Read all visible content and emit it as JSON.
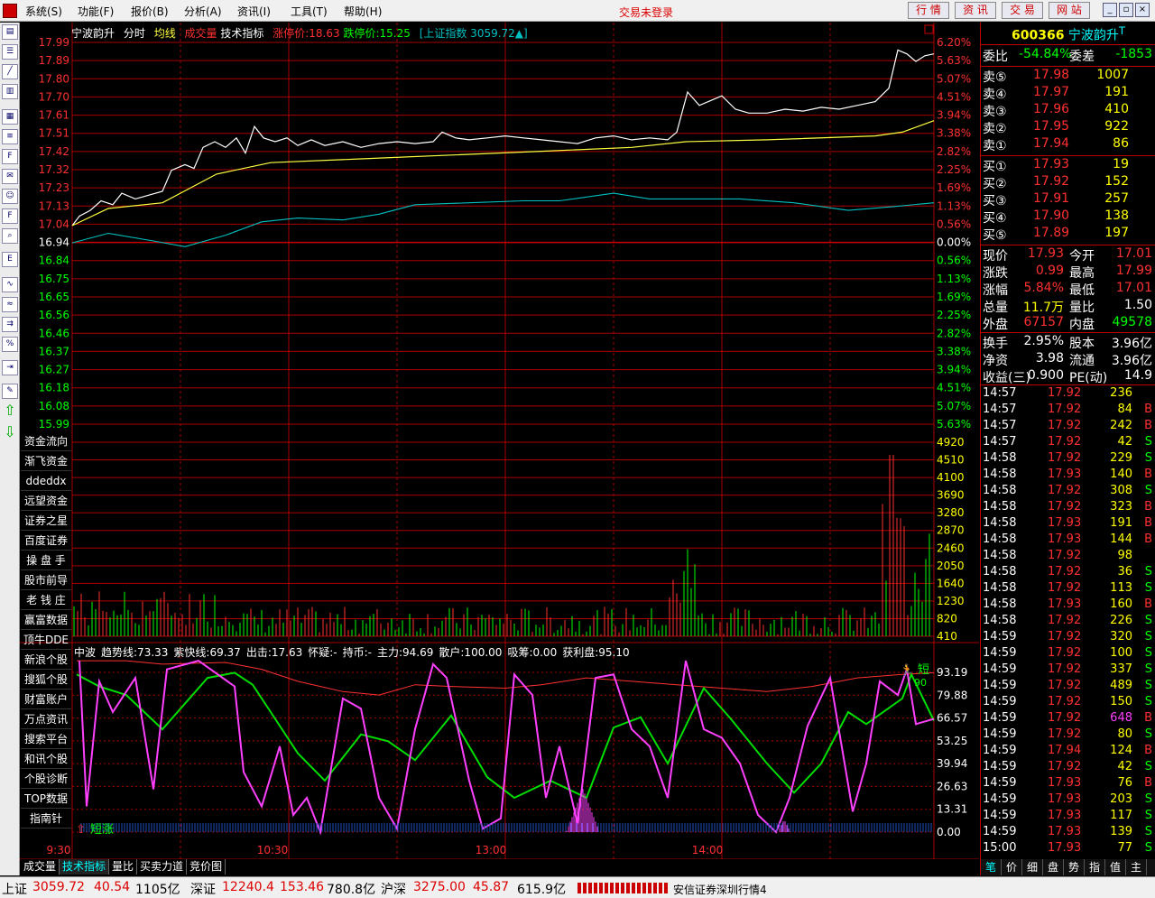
{
  "menu": {
    "items": [
      "系统(S)",
      "功能(F)",
      "报价(B)",
      "分析(A)",
      "资讯(I)",
      "工具(T)",
      "帮助(H)"
    ],
    "notice": "交易未登录",
    "quick_buttons": [
      "行 情",
      "资 讯",
      "交 易",
      "网 站"
    ]
  },
  "chart_info": {
    "name": "宁波韵升",
    "period": "分时",
    "avg_label": "均线",
    "vol_label": "成交量",
    "tech_label": "技术指标",
    "limit_up": "涨停价:18.63",
    "limit_down": "跌停价:15.25",
    "index": "[上证指数 3059.72▲]"
  },
  "price_axis": {
    "left": [
      "17.99",
      "17.89",
      "17.80",
      "17.70",
      "17.61",
      "17.51",
      "17.42",
      "17.32",
      "17.23",
      "17.13",
      "17.04",
      "16.94",
      "16.84",
      "16.75",
      "16.65",
      "16.56",
      "16.46",
      "16.37",
      "16.27",
      "16.18",
      "16.08",
      "15.99"
    ],
    "right": [
      "6.20%",
      "5.63%",
      "5.07%",
      "4.51%",
      "3.94%",
      "3.38%",
      "2.82%",
      "2.25%",
      "1.69%",
      "1.13%",
      "0.56%",
      "0.00%",
      "0.56%",
      "1.13%",
      "1.69%",
      "2.25%",
      "2.82%",
      "3.38%",
      "3.94%",
      "4.51%",
      "5.07%",
      "5.63%"
    ],
    "prev_close": 16.94
  },
  "volume_axis": [
    "4920",
    "4510",
    "4100",
    "3690",
    "3280",
    "2870",
    "2460",
    "2050",
    "1640",
    "1230",
    "820",
    "410"
  ],
  "indicator": {
    "labels": [
      "中波",
      "趋势线:73.33",
      "紫快线:69.37",
      "出击:17.63",
      "怀疑:-",
      "持币:-",
      "主力:94.69",
      "散户:100.00",
      "吸筹:0.00",
      "获利盘:95.10"
    ],
    "axis": [
      "93.19",
      "79.88",
      "66.57",
      "53.25",
      "39.94",
      "26.63",
      "13.31",
      "0.00"
    ],
    "signal_bottom": "短涨",
    "signal_top": "短",
    "signal_top2": "90"
  },
  "time_axis": [
    "9:30",
    "10:30",
    "13:00",
    "14:00"
  ],
  "left_nav": [
    "资金流向",
    "渐飞资金",
    "ddeddx",
    "远望资金",
    "证券之星",
    "百度证券",
    "操 盘 手",
    "股市前导",
    "老 钱 庄",
    "赢富数据",
    "顶牛DDE",
    "新浪个股",
    "搜狐个股",
    "财富账户",
    "万点资讯",
    "搜索平台",
    "和讯个股",
    "个股诊断",
    "TOP数据",
    "指南针"
  ],
  "toolbar_icons": [
    "quote-icon",
    "list-icon",
    "chart-icon",
    "kline-icon",
    "news-icon",
    "table-icon",
    "f10-icon",
    "mail-icon",
    "users-icon",
    "f10b-icon",
    "search-icon",
    "etf-icon",
    "trend-icon",
    "compare-icon",
    "multi-icon",
    "percent-icon",
    "export-icon",
    "pen-icon",
    "up-arrow-icon",
    "down-arrow-icon"
  ],
  "bottom_tabs": [
    "成交量",
    "技术指标",
    "量比",
    "买卖力道",
    "竞价图"
  ],
  "quote": {
    "code": "600366",
    "name": "宁波韵升",
    "suffix": "T",
    "weibi_label": "委比",
    "weibi": "-54.84%",
    "weicha_label": "委差",
    "weicha": "-1853",
    "asks": [
      {
        "label": "卖⑤",
        "price": "17.98",
        "vol": "1007"
      },
      {
        "label": "卖④",
        "price": "17.97",
        "vol": "191"
      },
      {
        "label": "卖③",
        "price": "17.96",
        "vol": "410"
      },
      {
        "label": "卖②",
        "price": "17.95",
        "vol": "922"
      },
      {
        "label": "卖①",
        "price": "17.94",
        "vol": "86"
      }
    ],
    "bids": [
      {
        "label": "买①",
        "price": "17.93",
        "vol": "19"
      },
      {
        "label": "买②",
        "price": "17.92",
        "vol": "152"
      },
      {
        "label": "买③",
        "price": "17.91",
        "vol": "257"
      },
      {
        "label": "买④",
        "price": "17.90",
        "vol": "138"
      },
      {
        "label": "买⑤",
        "price": "17.89",
        "vol": "197"
      }
    ],
    "stats": [
      {
        "l1": "现价",
        "v1": "17.93",
        "c1": "#ff3030",
        "l2": "今开",
        "v2": "17.01",
        "c2": "#ff3030"
      },
      {
        "l1": "涨跌",
        "v1": "0.99",
        "c1": "#ff3030",
        "l2": "最高",
        "v2": "17.99",
        "c2": "#ff3030"
      },
      {
        "l1": "涨幅",
        "v1": "5.84%",
        "c1": "#ff3030",
        "l2": "最低",
        "v2": "17.01",
        "c2": "#ff3030"
      },
      {
        "l1": "总量",
        "v1": "11.7万",
        "c1": "#ffff00",
        "l2": "量比",
        "v2": "1.50",
        "c2": "#ffffff"
      },
      {
        "l1": "外盘",
        "v1": "67157",
        "c1": "#ff3030",
        "l2": "内盘",
        "v2": "49578",
        "c2": "#00ff00"
      }
    ],
    "stats2": [
      {
        "l1": "换手",
        "v1": "2.95%",
        "l2": "股本",
        "v2": "3.96亿"
      },
      {
        "l1": "净资",
        "v1": "3.98",
        "l2": "流通",
        "v2": "3.96亿"
      },
      {
        "l1": "收益(三)",
        "v1": "0.900",
        "l2": "PE(动)",
        "v2": "14.9"
      }
    ]
  },
  "ticks": [
    {
      "t": "14:57",
      "p": "17.92",
      "v": "236",
      "d": ""
    },
    {
      "t": "14:57",
      "p": "17.92",
      "v": "84",
      "d": "B"
    },
    {
      "t": "14:57",
      "p": "17.92",
      "v": "242",
      "d": "B"
    },
    {
      "t": "14:57",
      "p": "17.92",
      "v": "42",
      "d": "S"
    },
    {
      "t": "14:58",
      "p": "17.92",
      "v": "229",
      "d": "S"
    },
    {
      "t": "14:58",
      "p": "17.93",
      "v": "140",
      "d": "B"
    },
    {
      "t": "14:58",
      "p": "17.92",
      "v": "308",
      "d": "S"
    },
    {
      "t": "14:58",
      "p": "17.92",
      "v": "323",
      "d": "B"
    },
    {
      "t": "14:58",
      "p": "17.93",
      "v": "191",
      "d": "B"
    },
    {
      "t": "14:58",
      "p": "17.93",
      "v": "144",
      "d": "B"
    },
    {
      "t": "14:58",
      "p": "17.92",
      "v": "98",
      "d": ""
    },
    {
      "t": "14:58",
      "p": "17.92",
      "v": "36",
      "d": "S"
    },
    {
      "t": "14:58",
      "p": "17.92",
      "v": "113",
      "d": "S"
    },
    {
      "t": "14:58",
      "p": "17.93",
      "v": "160",
      "d": "B"
    },
    {
      "t": "14:58",
      "p": "17.92",
      "v": "226",
      "d": "S"
    },
    {
      "t": "14:59",
      "p": "17.92",
      "v": "320",
      "d": "S"
    },
    {
      "t": "14:59",
      "p": "17.92",
      "v": "100",
      "d": "S"
    },
    {
      "t": "14:59",
      "p": "17.92",
      "v": "337",
      "d": "S"
    },
    {
      "t": "14:59",
      "p": "17.92",
      "v": "489",
      "d": "S"
    },
    {
      "t": "14:59",
      "p": "17.92",
      "v": "150",
      "d": "S"
    },
    {
      "t": "14:59",
      "p": "17.92",
      "v": "648",
      "d": "B"
    },
    {
      "t": "14:59",
      "p": "17.92",
      "v": "80",
      "d": "S"
    },
    {
      "t": "14:59",
      "p": "17.94",
      "v": "124",
      "d": "B"
    },
    {
      "t": "14:59",
      "p": "17.92",
      "v": "42",
      "d": "S"
    },
    {
      "t": "14:59",
      "p": "17.93",
      "v": "76",
      "d": "B"
    },
    {
      "t": "14:59",
      "p": "17.93",
      "v": "203",
      "d": "S"
    },
    {
      "t": "14:59",
      "p": "17.93",
      "v": "117",
      "d": "S"
    },
    {
      "t": "14:59",
      "p": "17.93",
      "v": "139",
      "d": "S"
    },
    {
      "t": "15:00",
      "p": "17.93",
      "v": "77",
      "d": "S"
    }
  ],
  "rp_tabs": [
    "笔",
    "价",
    "细",
    "盘",
    "势",
    "指",
    "值",
    "主"
  ],
  "status": {
    "sh_label": "上证",
    "sh": "3059.72",
    "sh_chg": "40.54",
    "sh_amt": "1105亿",
    "sz_label": "深证",
    "sz": "12240.4",
    "sz_chg": "153.46",
    "sz_amt": "780.8亿",
    "hs_label": "沪深",
    "hs": "3275.00",
    "hs_chg": "45.87",
    "hs_amt": "615.9亿",
    "broker": "安信证券深圳行情4"
  },
  "colors": {
    "up": "#ff3030",
    "down": "#00ff00",
    "grid": "#aa0000",
    "avg": "#ffff40",
    "index": "#00c0c0"
  }
}
